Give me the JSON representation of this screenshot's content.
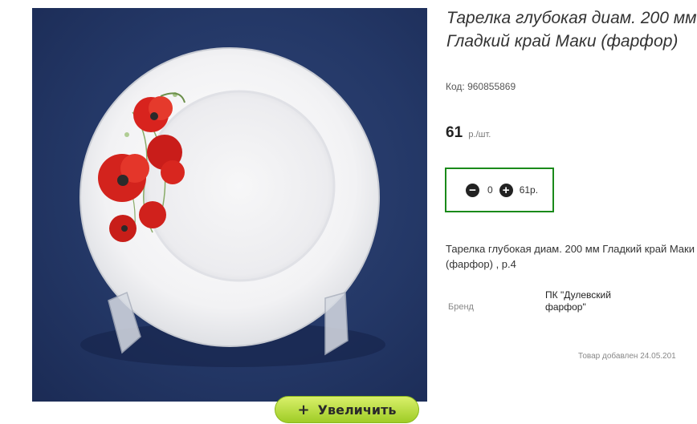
{
  "product": {
    "title": "Тарелка глубокая диам. 200 мм Гладкий край Маки (фарфор)",
    "sku": "Код: 960855869",
    "price": "61",
    "price_unit": "р./шт.",
    "quantity": "0",
    "total": "61р.",
    "description": "Тарелка глубокая диам. 200 мм Гладкий край Маки (фарфор) , р.4",
    "brand_label": "Бренд",
    "brand_value": "ПК \"Дулевский фарфор\"",
    "added_date": "Товар добавлен 24.05.201"
  },
  "zoom_button": {
    "label": "Увеличить",
    "icon": "+"
  },
  "colors": {
    "qty_border": "#1a8a1a",
    "zoom_button": "#b7dd3a",
    "photo_background": "#243867"
  }
}
